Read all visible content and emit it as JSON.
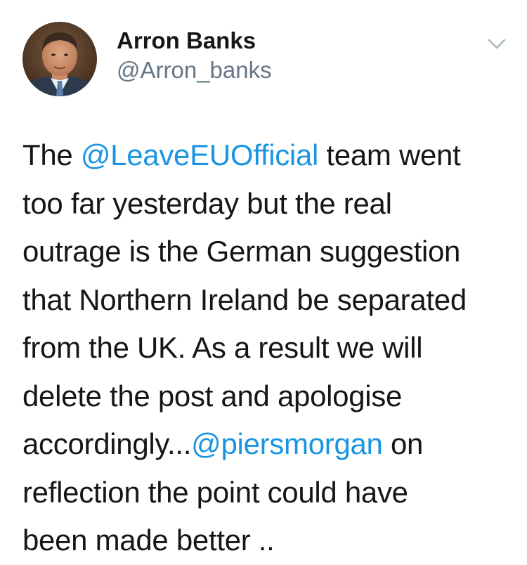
{
  "author": {
    "name": "Arron Banks",
    "handle": "@Arron_banks",
    "avatar_icon": "profile-photo"
  },
  "menu": {
    "icon": "chevron-down-icon"
  },
  "tweet": {
    "lines": [
      [
        {
          "t": "The ",
          "m": false
        },
        {
          "t": "@LeaveEUOfficial",
          "m": true
        },
        {
          "t": " team went",
          "m": false
        }
      ],
      [
        {
          "t": "too far yesterday but the real",
          "m": false
        }
      ],
      [
        {
          "t": "outrage is the German suggestion",
          "m": false
        }
      ],
      [
        {
          "t": "that Northern Ireland be separated",
          "m": false
        }
      ],
      [
        {
          "t": "from the UK. As a result we will",
          "m": false
        }
      ],
      [
        {
          "t": "delete the post and apologise",
          "m": false
        }
      ],
      [
        {
          "t": "accordingly...",
          "m": false
        },
        {
          "t": "@piersmorgan",
          "m": true
        },
        {
          "t": " on",
          "m": false
        }
      ],
      [
        {
          "t": "reflection the point could have",
          "m": false
        }
      ],
      [
        {
          "t": "been made better ..",
          "m": false
        }
      ]
    ]
  },
  "colors": {
    "text": "#14171a",
    "secondary": "#657786",
    "link": "#1b95e0"
  }
}
